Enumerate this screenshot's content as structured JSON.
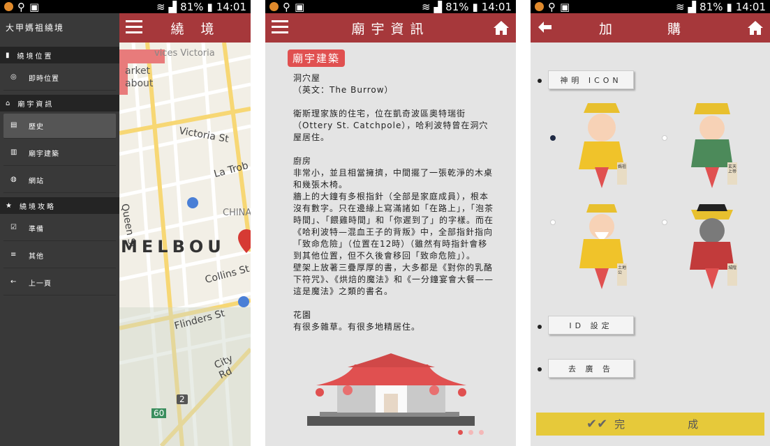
{
  "status": {
    "battery": "81%",
    "time": "14:01"
  },
  "colors": {
    "accent": "#a6383b",
    "tag": "#e05050",
    "drawer": "#393939",
    "done": "#e6c93a"
  },
  "phone1": {
    "app_title": "大甲媽祖繞境",
    "appbar_title": "繞 境",
    "menu": [
      {
        "type": "section",
        "icon": "map-icon",
        "label": "繞境位置"
      },
      {
        "type": "item",
        "icon": "location-target-icon",
        "label": "即時位置"
      },
      {
        "type": "section",
        "icon": "temple-icon",
        "label": "廟宇資訊"
      },
      {
        "type": "item",
        "icon": "clipboard-icon",
        "label": "歷史",
        "active": true
      },
      {
        "type": "item",
        "icon": "document-icon",
        "label": "廟宇建築"
      },
      {
        "type": "item",
        "icon": "globe-icon",
        "label": "網站"
      },
      {
        "type": "section",
        "icon": "star-icon",
        "label": "繞境攻略"
      },
      {
        "type": "item",
        "icon": "checklist-icon",
        "label": "準備"
      },
      {
        "type": "item",
        "icon": "list-icon",
        "label": "其他"
      },
      {
        "type": "item",
        "icon": "arrow-left-icon",
        "label": "上一頁"
      }
    ],
    "map_labels": [
      "vices Victoria",
      "arket",
      "about",
      "Victoria St",
      "La Trob",
      "Queen St",
      "CHINA",
      "MELBOU",
      "Collins St",
      "Flinders St",
      "City Rd",
      "2",
      "60"
    ]
  },
  "phone2": {
    "appbar_title": "廟宇資訊",
    "tag": "廟宇建築",
    "body": "洞穴屋\n（英文：The Burrow）\n\n衛斯理家族的住宅，位在凱奇波區奧特瑞街（Ottery St. Catchpole），哈利波特曾在洞穴屋居住。\n\n廚房\n非常小，並且相當擁擠，中間擺了一張乾淨的木桌和幾張木椅。\n牆上的大鐘有多根指針（全部是家庭成員），根本沒有數字。只在邊緣上寫滿諸如「在路上」，「泡茶時間」、「餵雞時間」和「你遲到了」的字樣。而在《哈利波特—混血王子的背叛》中，全部指針指向「致命危險」（位置在12時）（雖然有時指針會移到其他位置，但不久後會移回「致命危險」）。\n壁架上放著三疊厚厚的書，大多都是《對你的乳酪下符咒》、《烘焙的魔法》和《一分鐘宴會大餐——這是魔法》之類的書名。\n\n花園\n有很多雜草。有很多地精居住。"
  },
  "phone3": {
    "appbar_title": "加　購",
    "icon_button": "神明 ICON",
    "id_button": "ID 設定",
    "ad_button": "去 廣 告",
    "done_button": "完　　　　　　成",
    "gods": [
      {
        "name": "媽祖",
        "selected": true
      },
      {
        "name": "玄天上帝",
        "selected": false
      },
      {
        "name": "土地公",
        "selected": false
      },
      {
        "name": "城隍",
        "selected": false
      }
    ]
  }
}
